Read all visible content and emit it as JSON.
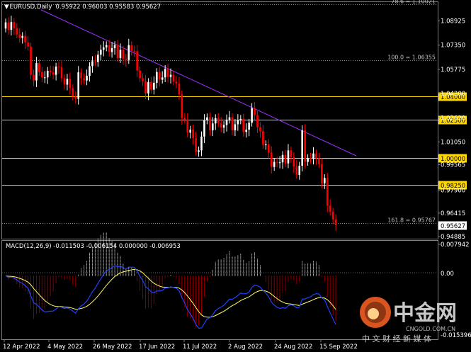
{
  "header": {
    "symbol": "EURUSD,Daily",
    "ohlc": "0.95922 0.96003 0.95583 0.95627"
  },
  "price_axis": {
    "labels": [
      "1.08925",
      "1.07350",
      "1.05775",
      "1.04200",
      "1.02620",
      "1.01050",
      "0.99565",
      "0.97900",
      "0.96415",
      "0.94885"
    ]
  },
  "levels": [
    {
      "label": "1.04000",
      "price": 1.04
    },
    {
      "label": "1.02500",
      "price": 1.025
    },
    {
      "label": "1.00000",
      "price": 1.0
    },
    {
      "label": "0.98250",
      "price": 0.9825
    }
  ],
  "current_price": {
    "label": "0.95627",
    "price": 0.95627
  },
  "fibo": [
    {
      "label": "78.6 = 1.10021",
      "price": 1.10021
    },
    {
      "label": "100.0 = 1.06355",
      "price": 1.06355
    },
    {
      "label": "161.8 = 0.95767",
      "price": 0.95767
    }
  ],
  "macd": {
    "title": "MACD(12,26,9) -0.011503 -0.006154 0.000000 -0.006953",
    "axis": {
      "top": "0.007942",
      "zero": "0.00",
      "bottom": "-0.015396"
    }
  },
  "time_axis": {
    "labels": [
      "12 Apr 2022",
      "4 May 2022",
      "26 May 2022",
      "17 Jun 2022",
      "11 Jul 2022",
      "2 Aug 2022",
      "24 Aug 2022",
      "15 Sep 2022"
    ]
  },
  "watermark": {
    "logo_text": "中金网",
    "sub_text": "中 文 财 经 新 媒 体",
    "url": "CNGOLD.COM.CN"
  },
  "colors": {
    "bull": "#ffffff",
    "bear": "#ff0000",
    "level": "#ffd700",
    "trendline": "#9b30ff",
    "macd_main": "#ffff66",
    "macd_signal": "#2040ff"
  },
  "chart_data": {
    "type": "candlestick",
    "symbol": "EURUSD",
    "timeframe": "Daily",
    "ylim": [
      0.9475,
      1.1015
    ],
    "x_labels": [
      "12 Apr 2022",
      "4 May 2022",
      "26 May 2022",
      "17 Jun 2022",
      "11 Jul 2022",
      "2 Aug 2022",
      "24 Aug 2022",
      "15 Sep 2022"
    ],
    "closes": [
      1.0883,
      1.0835,
      1.0885,
      1.0845,
      1.0805,
      1.0782,
      1.0795,
      1.0752,
      1.0725,
      1.0542,
      1.0505,
      1.0618,
      1.056,
      1.0525,
      1.0525,
      1.0568,
      1.0558,
      1.0542,
      1.0595,
      1.0592,
      1.052,
      1.0478,
      1.0515,
      1.0455,
      1.04,
      1.0385,
      1.0558,
      1.052,
      1.0505,
      1.0535,
      1.0598,
      1.063,
      1.0625,
      1.0673,
      1.0705,
      1.072,
      1.0735,
      1.069,
      1.0715,
      1.0735,
      1.065,
      1.0705,
      1.0645,
      1.0638,
      1.0735,
      1.0698,
      1.0695,
      1.057,
      1.052,
      1.05,
      1.042,
      1.0495,
      1.0445,
      1.049,
      1.056,
      1.051,
      1.0525,
      1.058,
      1.0528,
      1.0542,
      1.0498,
      1.0485,
      1.0415,
      1.026,
      1.025,
      1.0165,
      1.0185,
      1.013,
      1.004,
      1.005,
      1.014,
      1.0245,
      1.0265,
      1.018,
      1.0225,
      1.026,
      1.0225,
      1.0198,
      1.0215,
      1.025,
      1.0265,
      1.018,
      1.022,
      1.0245,
      1.0255,
      1.017,
      1.0185,
      1.023,
      1.0325,
      1.028,
      1.02,
      1.0175,
      1.0085,
      1.009,
      1.0035,
      0.9942,
      0.9975,
      0.997,
      0.9972,
      1.002,
      0.9965,
      1.005,
      1.0005,
      0.9945,
      0.989,
      0.995,
      1.018,
      0.9975,
      1.0,
      0.9995,
      1.003,
      0.9999,
      0.996,
      0.9835,
      0.987,
      0.969,
      0.965,
      0.96,
      0.9563
    ],
    "macd": {
      "values": [
        -0.0115,
        -0.00615,
        0.0,
        -0.00695
      ],
      "series": [
        {
          "name": "MACD(12,26,9)",
          "style": "histogram"
        },
        {
          "name": "signal",
          "color": "yellow"
        },
        {
          "name": "line",
          "color": "blue"
        }
      ],
      "ylim": [
        -0.015396,
        0.007942
      ]
    }
  }
}
